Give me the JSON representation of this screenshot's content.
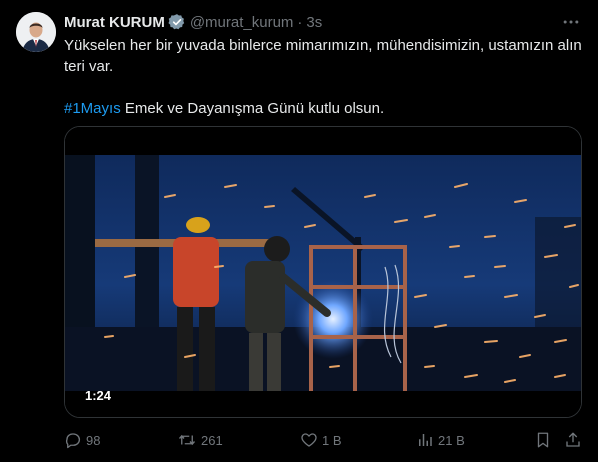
{
  "author": {
    "name": "Murat KURUM",
    "handle": "@murat_kurum",
    "separator": "·",
    "time": "3s"
  },
  "tweet": {
    "line1": "Yükselen her bir yuvada binlerce mimarımızın, mühendisimizin, ustamızın alın teri var.",
    "hashtag": "#1Mayıs",
    "line2": " Emek ve Dayanışma Günü kutlu olsun."
  },
  "media": {
    "duration": "1:24"
  },
  "actions": {
    "replies": "98",
    "retweets": "261",
    "likes": "1 B",
    "views": "21 B"
  },
  "colors": {
    "background": "#000000",
    "text": "#e7e9ea",
    "muted": "#71767b",
    "link": "#1d9bf0",
    "border": "#2f3336"
  },
  "icons": {
    "verified": "verified-badge-icon",
    "more": "more-icon",
    "reply": "reply-icon",
    "retweet": "retweet-icon",
    "like": "heart-icon",
    "views": "views-icon",
    "bookmark": "bookmark-icon",
    "share": "share-icon"
  }
}
